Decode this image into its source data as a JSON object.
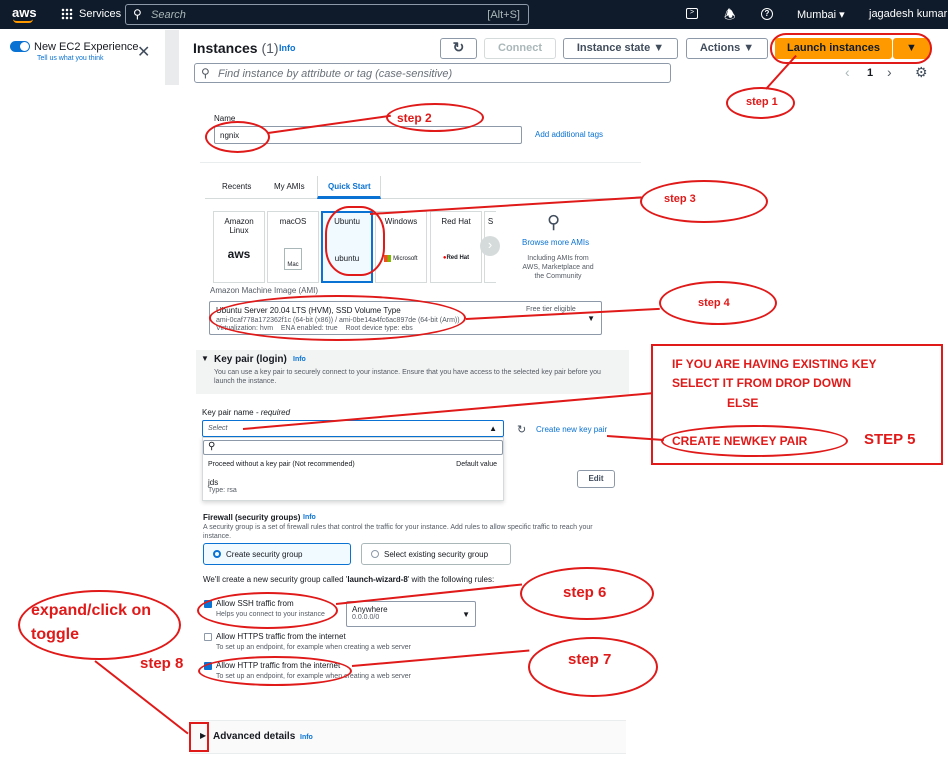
{
  "topnav": {
    "logo": "aws",
    "services": "Services",
    "search_placeholder": "Search",
    "shortcut": "[Alt+S]",
    "region": "Mumbai",
    "user": "jagadesh kumar"
  },
  "sidepanel": {
    "toggle_label": "New EC2 Experience",
    "feedback_link": "Tell us what you think"
  },
  "instances": {
    "title": "Instances",
    "count": "(1)",
    "info": "Info",
    "connect": "Connect",
    "instance_state": "Instance state",
    "actions": "Actions",
    "launch": "Launch instances",
    "filter_placeholder": "Find instance by attribute or tag (case-sensitive)",
    "page": "1"
  },
  "name": {
    "label": "Name",
    "value": "ngnix",
    "add_tags": "Add additional tags"
  },
  "ami_tabs": [
    "Recents",
    "My AMIs",
    "Quick Start"
  ],
  "ami_cards": [
    {
      "name": "Amazon Linux",
      "logo": "aws"
    },
    {
      "name": "macOS",
      "logo": "Mac"
    },
    {
      "name": "Ubuntu",
      "logo": "ubuntu"
    },
    {
      "name": "Windows",
      "logo": "Microsoft"
    },
    {
      "name": "Red Hat",
      "logo": "Red Hat"
    },
    {
      "name": "S",
      "logo": ""
    }
  ],
  "browse": {
    "link": "Browse more AMIs",
    "desc": "Including AMIs from AWS, Marketplace and the Community"
  },
  "ami": {
    "label": "Amazon Machine Image (AMI)",
    "title": "Ubuntu Server 20.04 LTS (HVM), SSD Volume Type",
    "ids": "ami-0caf778a172362f1c (64-bit (x86)) / ami-0be14a4fc6ac897de (64-bit (Arm))",
    "meta": "Virtualization: hvm    ENA enabled: true    Root device type: ebs",
    "tier": "Free tier eligible"
  },
  "keypair": {
    "heading": "Key pair (login)",
    "info": "Info",
    "desc": "You can use a key pair to securely connect to your instance. Ensure that you have access to the selected key pair before you launch the instance.",
    "label": "Key pair name",
    "required": "- required",
    "select": "Select",
    "create": "Create new key pair",
    "opt1": "Proceed without a key pair (Not recommended)",
    "opt1_default": "Default value",
    "opt2": "jds",
    "opt2_type": "Type: rsa",
    "edit": "Edit"
  },
  "firewall": {
    "heading": "Firewall (security groups)",
    "info": "Info",
    "desc": "A security group is a set of firewall rules that control the traffic for your instance. Add rules to allow specific traffic to reach your instance.",
    "create": "Create security group",
    "existing": "Select existing security group",
    "note_pre": "We'll create a new security group called '",
    "note_name": "launch-wizard-8",
    "note_post": "' with the following rules:",
    "ssh": "Allow SSH traffic from",
    "ssh_desc": "Helps you connect to your instance",
    "anywhere": "Anywhere",
    "anywhere_cidr": "0.0.0.0/0",
    "https": "Allow HTTPS traffic from the internet",
    "https_desc": "To set up an endpoint, for example when creating a web server",
    "http": "Allow HTTP traffic from the internet",
    "http_desc": "To set up an endpoint, for example when creating a web server"
  },
  "advanced": {
    "label": "Advanced details",
    "info": "Info"
  },
  "annotations": {
    "step1": "step 1",
    "step2": "step 2",
    "step3": "step 3",
    "step4": "step 4",
    "step5": "STEP 5",
    "step6": "step 6",
    "step7": "step 7",
    "step8": "step 8",
    "note1": "IF YOU ARE HAVING EXISTING KEY",
    "note2": "SELECT IT FROM DROP DOWN",
    "note3": "ELSE",
    "note4": "CREATE NEWKEY PAIR",
    "expand1": "expand/click on",
    "expand2": "toggle"
  },
  "colors": {
    "nav": "#0f1b2a",
    "accent": "#ff9900",
    "link": "#0972d3",
    "annotation": "#e01919"
  }
}
